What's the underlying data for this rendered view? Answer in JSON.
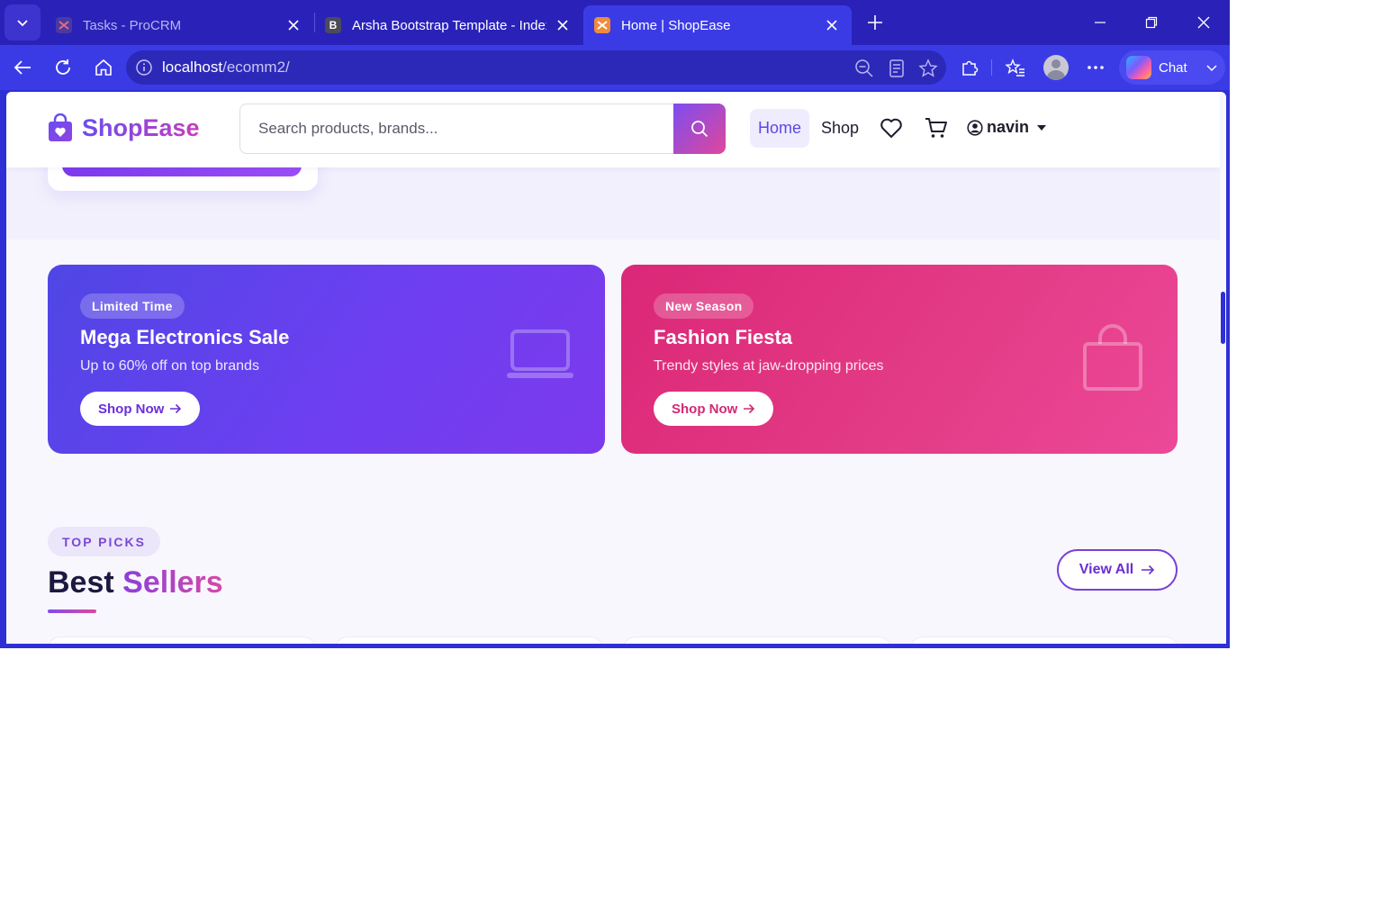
{
  "browser": {
    "tabs": [
      {
        "title": "Tasks - ProCRM",
        "active": false
      },
      {
        "title": "Arsha Bootstrap Template - Index",
        "active": false
      },
      {
        "title": "Home | ShopEase",
        "active": true
      }
    ],
    "address": {
      "host": "localhost",
      "path": "/ecomm2/"
    },
    "chat_label": "Chat"
  },
  "site": {
    "brand": "ShopEase",
    "search_placeholder": "Search products, brands...",
    "nav": {
      "home": "Home",
      "shop": "Shop"
    },
    "user": "navin"
  },
  "promos": [
    {
      "badge": "Limited Time",
      "title": "Mega Electronics Sale",
      "subtitle": "Up to 60% off on top brands",
      "button": "Shop Now",
      "icon": "laptop-icon"
    },
    {
      "badge": "New Season",
      "title": "Fashion Fiesta",
      "subtitle": "Trendy styles at jaw-dropping prices",
      "button": "Shop Now",
      "icon": "shopping-bag-icon"
    }
  ],
  "best_sellers": {
    "eyebrow": "TOP PICKS",
    "title_plain": "Best",
    "title_accent": "Sellers",
    "view_all": "View All"
  },
  "colors": {
    "accent": "#7c4df0",
    "pink": "#e0479b",
    "browser_chrome": "#2f2fd6"
  }
}
